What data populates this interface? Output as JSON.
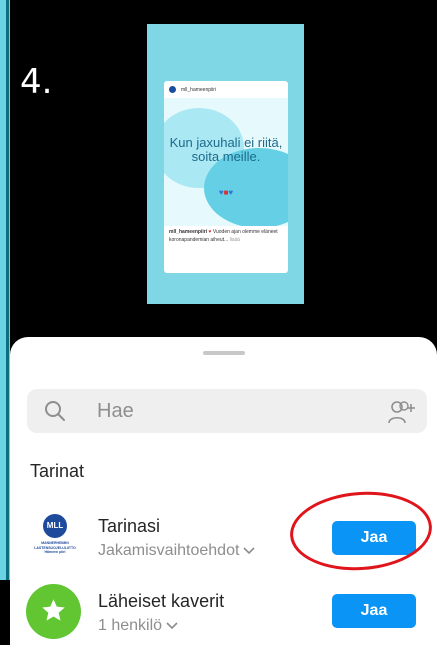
{
  "step": {
    "number": "4."
  },
  "story": {
    "username": "mll_hameenpiiri",
    "quote": "Kun jaxuhali ei riitä, soita meille.",
    "caption_user": "mll_hameenpiiri",
    "caption_text": "Vuoden ajan olemme eläneet koronapandemian aiheut...",
    "caption_more": "lisää"
  },
  "search": {
    "placeholder": "Hae"
  },
  "section": {
    "title": "Tarinat"
  },
  "rows": [
    {
      "title": "Tarinasi",
      "subtitle": "Jakamisvaihtoehdot",
      "button": "Jaa",
      "avatar_text": "MLL",
      "avatar_caption": "MANNERHEIMIN LASTENSUOJELULIITTO Hämeen piiri"
    },
    {
      "title": "Läheiset kaverit",
      "subtitle": "1 henkilö",
      "button": "Jaa"
    }
  ],
  "colors": {
    "accent": "#0a95f6",
    "highlight": "#e0141b",
    "close_friends": "#61c631"
  }
}
